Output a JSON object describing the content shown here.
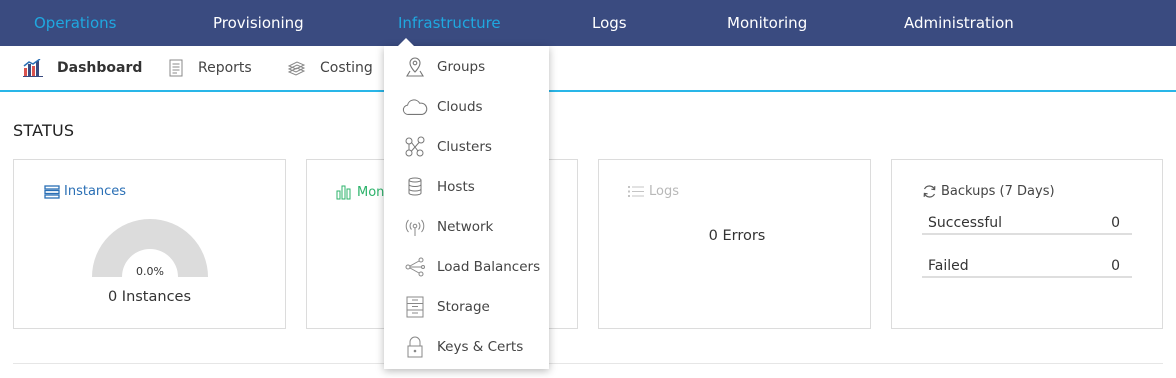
{
  "topnav": {
    "items": [
      {
        "label": "Operations",
        "active": true
      },
      {
        "label": "Provisioning"
      },
      {
        "label": "Infrastructure",
        "active": true
      },
      {
        "label": "Logs"
      },
      {
        "label": "Monitoring"
      },
      {
        "label": "Administration"
      }
    ]
  },
  "subnav": {
    "items": [
      {
        "label": "Dashboard",
        "icon": "dashboard-icon",
        "active": true
      },
      {
        "label": "Reports",
        "icon": "reports-icon"
      },
      {
        "label": "Costing",
        "icon": "costing-icon"
      }
    ]
  },
  "status": {
    "title": "STATUS",
    "instances": {
      "title": "Instances",
      "gauge_label": "0.0%",
      "gauge_fill": 0.0,
      "summary": "0 Instances"
    },
    "monitoring": {
      "title": "Mon"
    },
    "logs": {
      "title": "Logs",
      "summary": "0 Errors"
    },
    "backups": {
      "title": "Backups (7 Days)",
      "rows": [
        {
          "label": "Successful",
          "value": "0"
        },
        {
          "label": "Failed",
          "value": "0"
        }
      ]
    }
  },
  "dropdown": {
    "items": [
      {
        "label": "Groups",
        "icon": "map-pin-icon"
      },
      {
        "label": "Clouds",
        "icon": "cloud-icon"
      },
      {
        "label": "Clusters",
        "icon": "cluster-icon"
      },
      {
        "label": "Hosts",
        "icon": "database-icon"
      },
      {
        "label": "Network",
        "icon": "wifi-antenna-icon"
      },
      {
        "label": "Load Balancers",
        "icon": "share-icon"
      },
      {
        "label": "Storage",
        "icon": "cabinet-icon"
      },
      {
        "label": "Keys & Certs",
        "icon": "lock-icon"
      }
    ]
  },
  "colors": {
    "nav_bg": "#3a4b80",
    "accent": "#1fa8e0",
    "monitoring_green": "#2db36b",
    "instances_blue": "#2a6fb5"
  }
}
